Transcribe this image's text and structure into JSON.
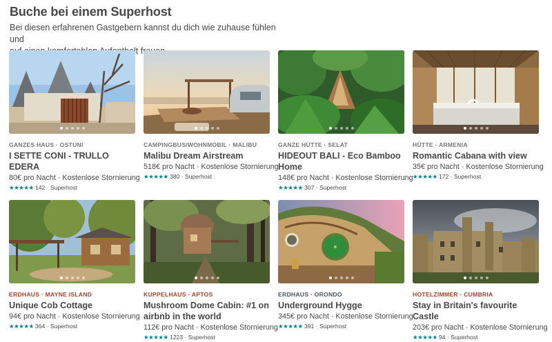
{
  "header": {
    "title": "Buche bei einem Superhost",
    "subtitle_line1": "Bei diesen erfahrenen Gastgebern kannst du dich wie zuhause fühlen und",
    "subtitle_line2": "auf einen komfortablen Aufenthalt freuen."
  },
  "stars_glyph": "★★★★★",
  "listings": [
    {
      "type": "GANZES HAUS · OSTUNI",
      "type_color": "#767676",
      "name": "I SETTE CONI - TRULLO EDERA",
      "price": "80€ pro Nacht · Kostenlose Stornierung",
      "reviews": "142",
      "badge": "Superhost",
      "photo_icon": "trullo-house-photo"
    },
    {
      "type": "CAMPINGBUS/WOHNMOBIL · MALIBU",
      "type_color": "#767676",
      "name": "Malibu Dream Airstream",
      "price": "518€ pro Nacht · Kostenlose Stornierung",
      "reviews": "380",
      "badge": "Superhost",
      "photo_icon": "airstream-photo"
    },
    {
      "type": "GANZE HÜTTE · SELAT",
      "type_color": "#767676",
      "name": "HIDEOUT BALI - Eco Bamboo Home",
      "price": "148€ pro Nacht · Kostenlose Stornierung",
      "reviews": "307",
      "badge": "Superhost",
      "photo_icon": "bamboo-hut-photo"
    },
    {
      "type": "HÜTTE · ARMENIA",
      "type_color": "#767676",
      "name": "Romantic Cabana with view",
      "price": "35€ pro Nacht · Kostenlose Stornierung",
      "reviews": "172",
      "badge": "Superhost",
      "photo_icon": "cabana-bedroom-photo"
    },
    {
      "type": "ERDHAUS · MAYNE ISLAND",
      "type_color": "#a8412b",
      "name": "Unique Cob Cottage",
      "price": "94€ pro Nacht · Kostenlose Stornierung",
      "reviews": "364",
      "badge": "Superhost",
      "photo_icon": "cob-cottage-photo"
    },
    {
      "type": "KUPPELHAUS · APTOS",
      "type_color": "#a8412b",
      "name": "Mushroom Dome Cabin: #1 on airbnb in the world",
      "price": "112€ pro Nacht · Kostenlose Stornierung",
      "reviews": "1223",
      "badge": "Superhost",
      "photo_icon": "mushroom-dome-photo"
    },
    {
      "type": "ERDHAUS · ORONDO",
      "type_color": "#41575d",
      "name": "Underground Hygge",
      "price": "345€ pro Nacht · Kostenlose Stornierung",
      "reviews": "391",
      "badge": "Superhost",
      "photo_icon": "hobbit-house-photo"
    },
    {
      "type": "HOTELZIMMER · CUMBRIA",
      "type_color": "#a8412b",
      "name": "Stay in Britain's favourite Castle",
      "price": "203€ pro Nacht · Kostenlose Stornierung",
      "reviews": "94",
      "badge": "Superhost",
      "photo_icon": "castle-photo"
    }
  ],
  "colors": {
    "text": "#484848",
    "star": "#008489"
  }
}
